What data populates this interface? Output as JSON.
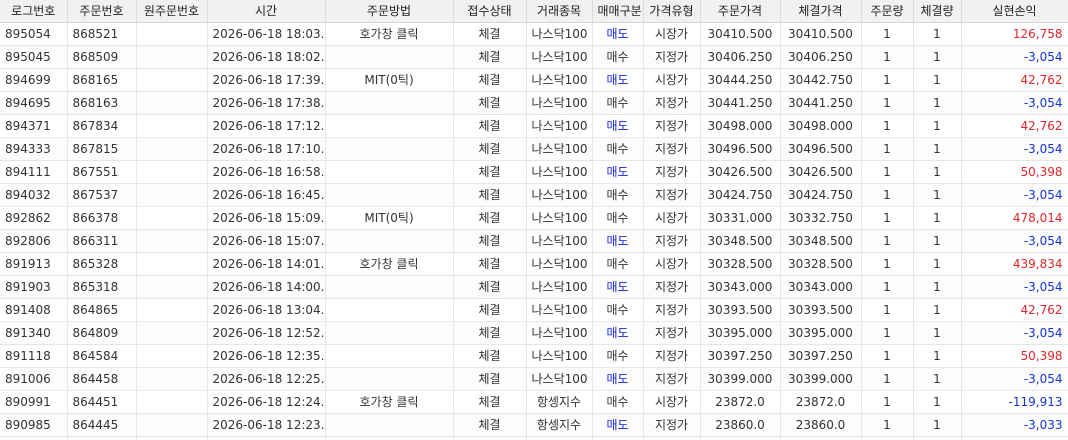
{
  "headers": [
    "로그번호",
    "주문번호",
    "원주문번호",
    "시간",
    "주문방법",
    "접수상태",
    "거래종목",
    "매매구분",
    "가격유형",
    "주문가격",
    "체결가격",
    "주문량",
    "체결량",
    "실현손익"
  ],
  "colors": {
    "sell": "#1424dc",
    "profit": "#e0262a",
    "loss": "#1435d8"
  },
  "rows": [
    {
      "log": "895054",
      "order": "868521",
      "orig": "",
      "time": "2026-06-18 18:03...",
      "method": "호가창 클릭",
      "status": "체결",
      "item": "나스닥100",
      "side": "매도",
      "ptype": "시장가",
      "oprice": "30410.500",
      "fprice": "30410.500",
      "oqty": "1",
      "fqty": "1",
      "pnl": "126,758"
    },
    {
      "log": "895045",
      "order": "868509",
      "orig": "",
      "time": "2026-06-18 18:02...",
      "method": "",
      "status": "체결",
      "item": "나스닥100",
      "side": "매수",
      "ptype": "지정가",
      "oprice": "30406.250",
      "fprice": "30406.250",
      "oqty": "1",
      "fqty": "1",
      "pnl": "-3,054"
    },
    {
      "log": "894699",
      "order": "868165",
      "orig": "",
      "time": "2026-06-18 17:39...",
      "method": "MIT(0틱)",
      "status": "체결",
      "item": "나스닥100",
      "side": "매도",
      "ptype": "시장가",
      "oprice": "30444.250",
      "fprice": "30442.750",
      "oqty": "1",
      "fqty": "1",
      "pnl": "42,762"
    },
    {
      "log": "894695",
      "order": "868163",
      "orig": "",
      "time": "2026-06-18 17:38...",
      "method": "",
      "status": "체결",
      "item": "나스닥100",
      "side": "매수",
      "ptype": "지정가",
      "oprice": "30441.250",
      "fprice": "30441.250",
      "oqty": "1",
      "fqty": "1",
      "pnl": "-3,054"
    },
    {
      "log": "894371",
      "order": "867834",
      "orig": "",
      "time": "2026-06-18 17:12...",
      "method": "",
      "status": "체결",
      "item": "나스닥100",
      "side": "매도",
      "ptype": "지정가",
      "oprice": "30498.000",
      "fprice": "30498.000",
      "oqty": "1",
      "fqty": "1",
      "pnl": "42,762"
    },
    {
      "log": "894333",
      "order": "867815",
      "orig": "",
      "time": "2026-06-18 17:10...",
      "method": "",
      "status": "체결",
      "item": "나스닥100",
      "side": "매수",
      "ptype": "지정가",
      "oprice": "30496.500",
      "fprice": "30496.500",
      "oqty": "1",
      "fqty": "1",
      "pnl": "-3,054"
    },
    {
      "log": "894111",
      "order": "867551",
      "orig": "",
      "time": "2026-06-18 16:58...",
      "method": "",
      "status": "체결",
      "item": "나스닥100",
      "side": "매도",
      "ptype": "지정가",
      "oprice": "30426.500",
      "fprice": "30426.500",
      "oqty": "1",
      "fqty": "1",
      "pnl": "50,398"
    },
    {
      "log": "894032",
      "order": "867537",
      "orig": "",
      "time": "2026-06-18 16:45...",
      "method": "",
      "status": "체결",
      "item": "나스닥100",
      "side": "매수",
      "ptype": "지정가",
      "oprice": "30424.750",
      "fprice": "30424.750",
      "oqty": "1",
      "fqty": "1",
      "pnl": "-3,054"
    },
    {
      "log": "892862",
      "order": "866378",
      "orig": "",
      "time": "2026-06-18 15:09...",
      "method": "MIT(0틱)",
      "status": "체결",
      "item": "나스닥100",
      "side": "매수",
      "ptype": "시장가",
      "oprice": "30331.000",
      "fprice": "30332.750",
      "oqty": "1",
      "fqty": "1",
      "pnl": "478,014"
    },
    {
      "log": "892806",
      "order": "866311",
      "orig": "",
      "time": "2026-06-18 15:07...",
      "method": "",
      "status": "체결",
      "item": "나스닥100",
      "side": "매도",
      "ptype": "지정가",
      "oprice": "30348.500",
      "fprice": "30348.500",
      "oqty": "1",
      "fqty": "1",
      "pnl": "-3,054"
    },
    {
      "log": "891913",
      "order": "865328",
      "orig": "",
      "time": "2026-06-18 14:01...",
      "method": "호가창 클릭",
      "status": "체결",
      "item": "나스닥100",
      "side": "매수",
      "ptype": "시장가",
      "oprice": "30328.500",
      "fprice": "30328.500",
      "oqty": "1",
      "fqty": "1",
      "pnl": "439,834"
    },
    {
      "log": "891903",
      "order": "865318",
      "orig": "",
      "time": "2026-06-18 14:00...",
      "method": "",
      "status": "체결",
      "item": "나스닥100",
      "side": "매도",
      "ptype": "지정가",
      "oprice": "30343.000",
      "fprice": "30343.000",
      "oqty": "1",
      "fqty": "1",
      "pnl": "-3,054"
    },
    {
      "log": "891408",
      "order": "864865",
      "orig": "",
      "time": "2026-06-18 13:04...",
      "method": "",
      "status": "체결",
      "item": "나스닥100",
      "side": "매수",
      "ptype": "지정가",
      "oprice": "30393.500",
      "fprice": "30393.500",
      "oqty": "1",
      "fqty": "1",
      "pnl": "42,762"
    },
    {
      "log": "891340",
      "order": "864809",
      "orig": "",
      "time": "2026-06-18 12:52...",
      "method": "",
      "status": "체결",
      "item": "나스닥100",
      "side": "매도",
      "ptype": "지정가",
      "oprice": "30395.000",
      "fprice": "30395.000",
      "oqty": "1",
      "fqty": "1",
      "pnl": "-3,054"
    },
    {
      "log": "891118",
      "order": "864584",
      "orig": "",
      "time": "2026-06-18 12:35...",
      "method": "",
      "status": "체결",
      "item": "나스닥100",
      "side": "매수",
      "ptype": "지정가",
      "oprice": "30397.250",
      "fprice": "30397.250",
      "oqty": "1",
      "fqty": "1",
      "pnl": "50,398"
    },
    {
      "log": "891006",
      "order": "864458",
      "orig": "",
      "time": "2026-06-18 12:25...",
      "method": "",
      "status": "체결",
      "item": "나스닥100",
      "side": "매도",
      "ptype": "지정가",
      "oprice": "30399.000",
      "fprice": "30399.000",
      "oqty": "1",
      "fqty": "1",
      "pnl": "-3,054"
    },
    {
      "log": "890991",
      "order": "864451",
      "orig": "",
      "time": "2026-06-18 12:24...",
      "method": "호가창 클릭",
      "status": "체결",
      "item": "항셍지수",
      "side": "매수",
      "ptype": "시장가",
      "oprice": "23872.0",
      "fprice": "23872.0",
      "oqty": "1",
      "fqty": "1",
      "pnl": "-119,913"
    },
    {
      "log": "890985",
      "order": "864445",
      "orig": "",
      "time": "2026-06-18 12:23...",
      "method": "",
      "status": "체결",
      "item": "항셍지수",
      "side": "매도",
      "ptype": "지정가",
      "oprice": "23860.0",
      "fprice": "23860.0",
      "oqty": "1",
      "fqty": "1",
      "pnl": "-3,033"
    }
  ]
}
